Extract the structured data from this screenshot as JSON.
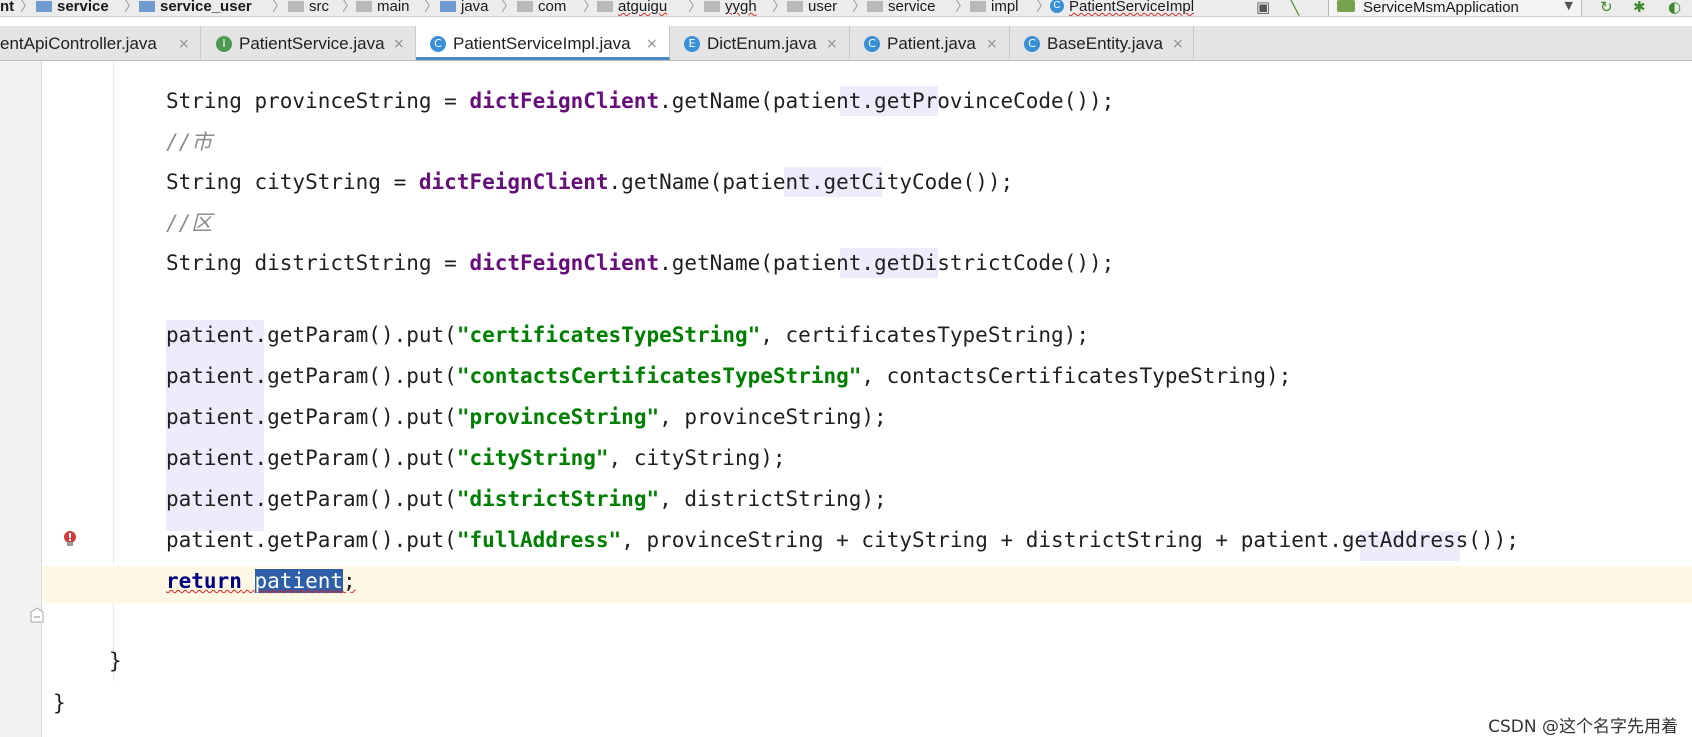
{
  "breadcrumb": {
    "items": [
      "nt",
      "service",
      "service_user",
      "src",
      "main",
      "java",
      "com",
      "atguigu",
      "yygh",
      "user",
      "service",
      "impl",
      "PatientServiceImpl"
    ],
    "separator": "〉"
  },
  "run_config": {
    "label": "ServiceMsmApplication"
  },
  "tabs": [
    {
      "label": "entApiController.java",
      "icon": "C"
    },
    {
      "label": "PatientService.java",
      "icon": "I"
    },
    {
      "label": "PatientServiceImpl.java",
      "icon": "C"
    },
    {
      "label": "DictEnum.java",
      "icon": "E"
    },
    {
      "label": "Patient.java",
      "icon": "C"
    },
    {
      "label": "BaseEntity.java",
      "icon": "C"
    }
  ],
  "tab_close": "×",
  "code": {
    "l1": {
      "a": "String provinceString = ",
      "b": "dictFeignClient",
      "c": ".getName(",
      "d": "patient",
      "e": ".getProvinceCode());"
    },
    "l2": {
      "a": "//市"
    },
    "l3": {
      "a": "String cityString = ",
      "b": "dictFeignClient",
      "c": ".getName(",
      "d": "patient",
      "e": ".getCityCode());"
    },
    "l4": {
      "a": "//区"
    },
    "l5": {
      "a": "String districtString = ",
      "b": "dictFeignClient",
      "c": ".getName(",
      "d": "patient",
      "e": ".getDistrictCode());"
    },
    "l6": {
      "a": "patient",
      "b": ".getParam().put(",
      "c": "\"certificatesTypeString\"",
      "d": ", certificatesTypeString);"
    },
    "l7": {
      "a": "patient",
      "b": ".getParam().put(",
      "c": "\"contactsCertificatesTypeString\"",
      "d": ", contactsCertificatesTypeString);"
    },
    "l8": {
      "a": "patient",
      "b": ".getParam().put(",
      "c": "\"provinceString\"",
      "d": ", provinceString);"
    },
    "l9": {
      "a": "patient",
      "b": ".getParam().put(",
      "c": "\"cityString\"",
      "d": ", cityString);"
    },
    "l10": {
      "a": "patient",
      "b": ".getParam().put(",
      "c": "\"districtString\"",
      "d": ", districtString);"
    },
    "l11": {
      "a": "patient",
      "b": ".getParam().put(",
      "c": "\"fullAddress\"",
      "d": ", provinceString + cityString + districtString + ",
      "e": "patient",
      "f": ".getAddress());"
    },
    "l12": {
      "a": "return",
      "b": " ",
      "c": "patient",
      "d": ";"
    },
    "l13": {
      "a": "}"
    },
    "l14": {
      "a": "}"
    }
  },
  "watermark": "CSDN @这个名字先用着",
  "colors": {
    "selection": "#2f5fa8",
    "string": "#008000",
    "field": "#660e7a",
    "keyword": "#000080",
    "current_line": "#fdf8e4"
  }
}
